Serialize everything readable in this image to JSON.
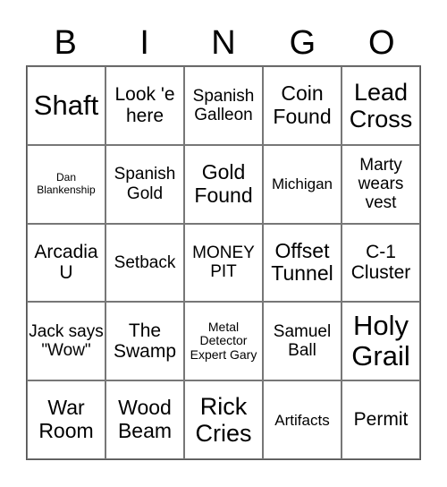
{
  "header": {
    "letters": [
      "B",
      "I",
      "N",
      "G",
      "O"
    ]
  },
  "card": {
    "rows": [
      [
        "Shaft",
        "Look 'e here",
        "Spanish Galleon",
        "Coin Found",
        "Lead Cross"
      ],
      [
        "Dan Blankenship",
        "Spanish Gold",
        "Gold Found",
        "Michigan",
        "Marty wears vest"
      ],
      [
        "Arcadia U",
        "Setback",
        "MONEY PIT",
        "Offset Tunnel",
        "C-1 Cluster"
      ],
      [
        "Jack says \"Wow\"",
        "The Swamp",
        "Metal Detector Expert Gary",
        "Samuel Ball",
        "Holy Grail"
      ],
      [
        "War Room",
        "Wood Beam",
        "Rick Cries",
        "Artifacts",
        "Permit"
      ]
    ]
  },
  "colors": {
    "text": "#000000",
    "grid_line": "#777777",
    "background": "#ffffff"
  }
}
